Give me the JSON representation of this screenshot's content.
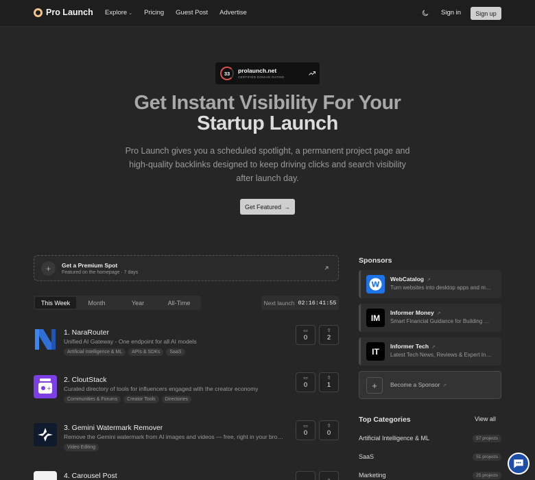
{
  "header": {
    "brand": "Pro Launch",
    "nav": [
      {
        "label": "Explore",
        "has_dropdown": true
      },
      {
        "label": "Pricing"
      },
      {
        "label": "Guest Post"
      },
      {
        "label": "Advertise"
      }
    ],
    "theme_icon": "moon-icon",
    "signin": "Sign in",
    "signup": "Sign up"
  },
  "hero": {
    "rating_value": "33",
    "rating_domain": "prolaunch.net",
    "rating_caption": "CERTIFIED DOMAIN RATING",
    "title_line1": "Get Instant Visibility For Your",
    "title_line2": "Startup Launch",
    "description": "Pro Launch gives you a scheduled spotlight, a permanent project page and high-quality backlinks designed to keep driving clicks and search visibility after launch day.",
    "cta": "Get Featured"
  },
  "premium": {
    "title": "Get a Premium Spot",
    "subtitle": "Featured on the homepage · 7 days"
  },
  "tabs": [
    "This Week",
    "Month",
    "Year",
    "All-Time"
  ],
  "active_tab": "This Week",
  "next_launch": {
    "label": "Next launch",
    "time": "02:16:41:55"
  },
  "projects": [
    {
      "rank_name": "1. NaraRouter",
      "description": "Unified AI Gateway - One endpoint for all AI models",
      "tags": [
        "Artificial Intelligence & ML",
        "APIs & SDKs",
        "SaaS"
      ],
      "comments": "0",
      "upvotes": "2"
    },
    {
      "rank_name": "2. CloutStack",
      "description": "Curated directory of tools for influencers engaged with the creator economy",
      "tags": [
        "Communities & Forums",
        "Creator Tools",
        "Directories"
      ],
      "comments": "0",
      "upvotes": "1"
    },
    {
      "rank_name": "3. Gemini Watermark Remover",
      "description": "Remove the Gemini watermark from AI images and videos — free, right in your browser",
      "tags": [
        "Video Editing"
      ],
      "comments": "0",
      "upvotes": "0"
    },
    {
      "rank_name": "4. Carousel Post",
      "description": "",
      "tags": [],
      "comments": "",
      "upvotes": ""
    }
  ],
  "sponsors": {
    "title": "Sponsors",
    "items": [
      {
        "name": "WebCatalog",
        "description": "Turn websites into desktop apps and more",
        "logo_text": "W",
        "logo_color": "#1e73e8"
      },
      {
        "name": "Informer Money",
        "description": "Smart Financial Guidance for Building Wealth",
        "logo_text": "IM",
        "logo_color": "#000000"
      },
      {
        "name": "Informer Tech",
        "description": "Latest Tech News, Reviews & Expert Insights",
        "logo_text": "IT",
        "logo_color": "#000000"
      }
    ],
    "become": "Become a Sponsor"
  },
  "categories": {
    "title": "Top Categories",
    "view_all": "View all",
    "items": [
      {
        "name": "Artificial Intelligence & ML",
        "count": "57 projects"
      },
      {
        "name": "SaaS",
        "count": "51 projects"
      },
      {
        "name": "Marketing",
        "count": "25 projects"
      }
    ]
  },
  "colors": {
    "background": "#262626",
    "header": "#1e1e1e",
    "accent_red": "#d9534f",
    "chat_blue": "#1d4fa8"
  }
}
